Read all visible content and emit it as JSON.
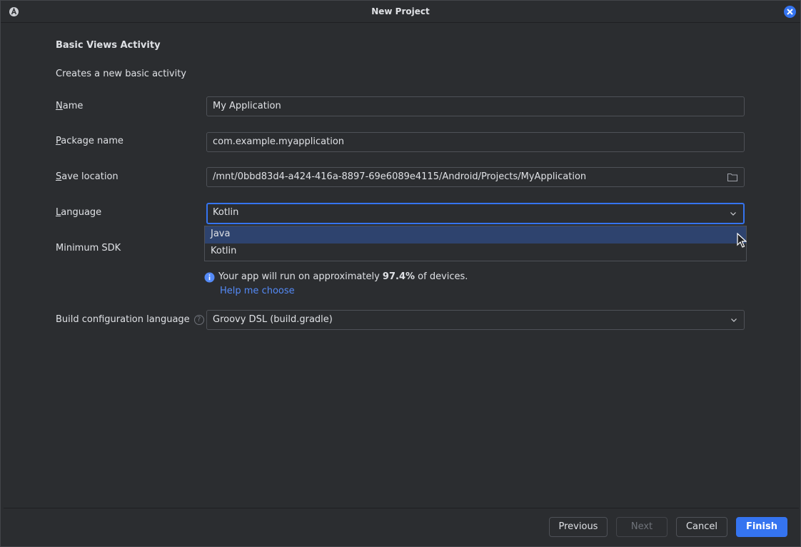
{
  "window": {
    "title": "New Project",
    "app_icon": "android-studio-icon",
    "close_icon": "close-icon"
  },
  "form": {
    "heading": "Basic Views Activity",
    "description": "Creates a new basic activity",
    "name": {
      "mnemonic": "N",
      "rest": "ame",
      "value": "My Application"
    },
    "package": {
      "mnemonic": "P",
      "rest": "ackage name",
      "value": "com.example.myapplication"
    },
    "save_location": {
      "mnemonic": "S",
      "rest": "ave location",
      "value": "/mnt/0bbd83d4-a424-416a-8897-69e6089e4115/Android/Projects/MyApplication"
    },
    "language": {
      "mnemonic": "L",
      "rest": "anguage",
      "value": "Kotlin",
      "options": [
        "Java",
        "Kotlin"
      ],
      "highlighted": "Java"
    },
    "min_sdk": {
      "label": "Minimum SDK"
    },
    "info": {
      "prefix": "Your app will run on approximately ",
      "percent": "97.4%",
      "suffix": " of devices.",
      "help_link": "Help me choose"
    },
    "build_config": {
      "label": "Build configuration language",
      "value": "Groovy DSL (build.gradle)"
    }
  },
  "footer": {
    "previous": "Previous",
    "next": "Next",
    "cancel": "Cancel",
    "finish": "Finish"
  },
  "colors": {
    "accent": "#3574f0",
    "link": "#548af7",
    "selection": "#2e436e",
    "background": "#2b2d30"
  }
}
